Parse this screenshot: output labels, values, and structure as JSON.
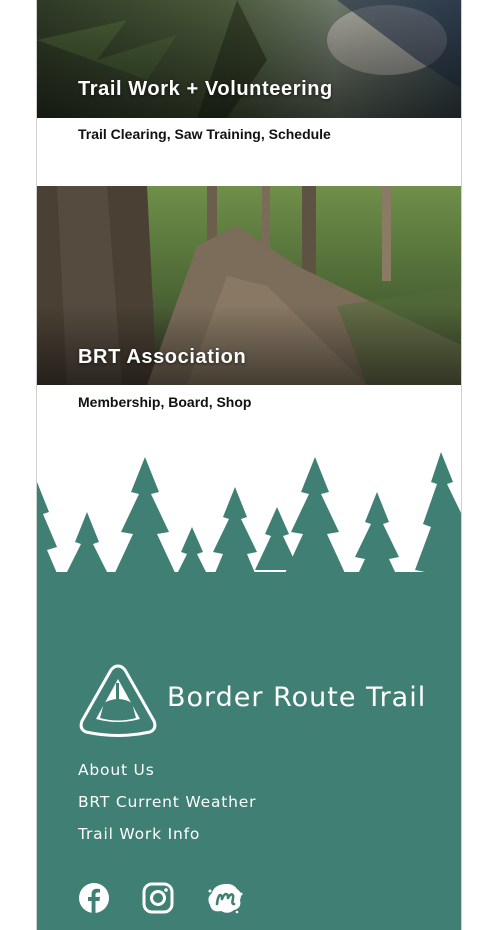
{
  "cards": [
    {
      "title": "Trail Work + Volunteering",
      "subtitle": "Trail Clearing, Saw Training, Schedule"
    },
    {
      "title": "BRT Association",
      "subtitle": "Membership, Board, Shop"
    }
  ],
  "footer": {
    "brand": "Border Route Trail",
    "links": [
      "About Us",
      "BRT Current Weather",
      "Trail Work Info"
    ],
    "social_icons": [
      "facebook-icon",
      "instagram-icon",
      "meetup-icon"
    ]
  },
  "colors": {
    "footer_green": "#3f7f74",
    "text_white": "#ffffff"
  }
}
